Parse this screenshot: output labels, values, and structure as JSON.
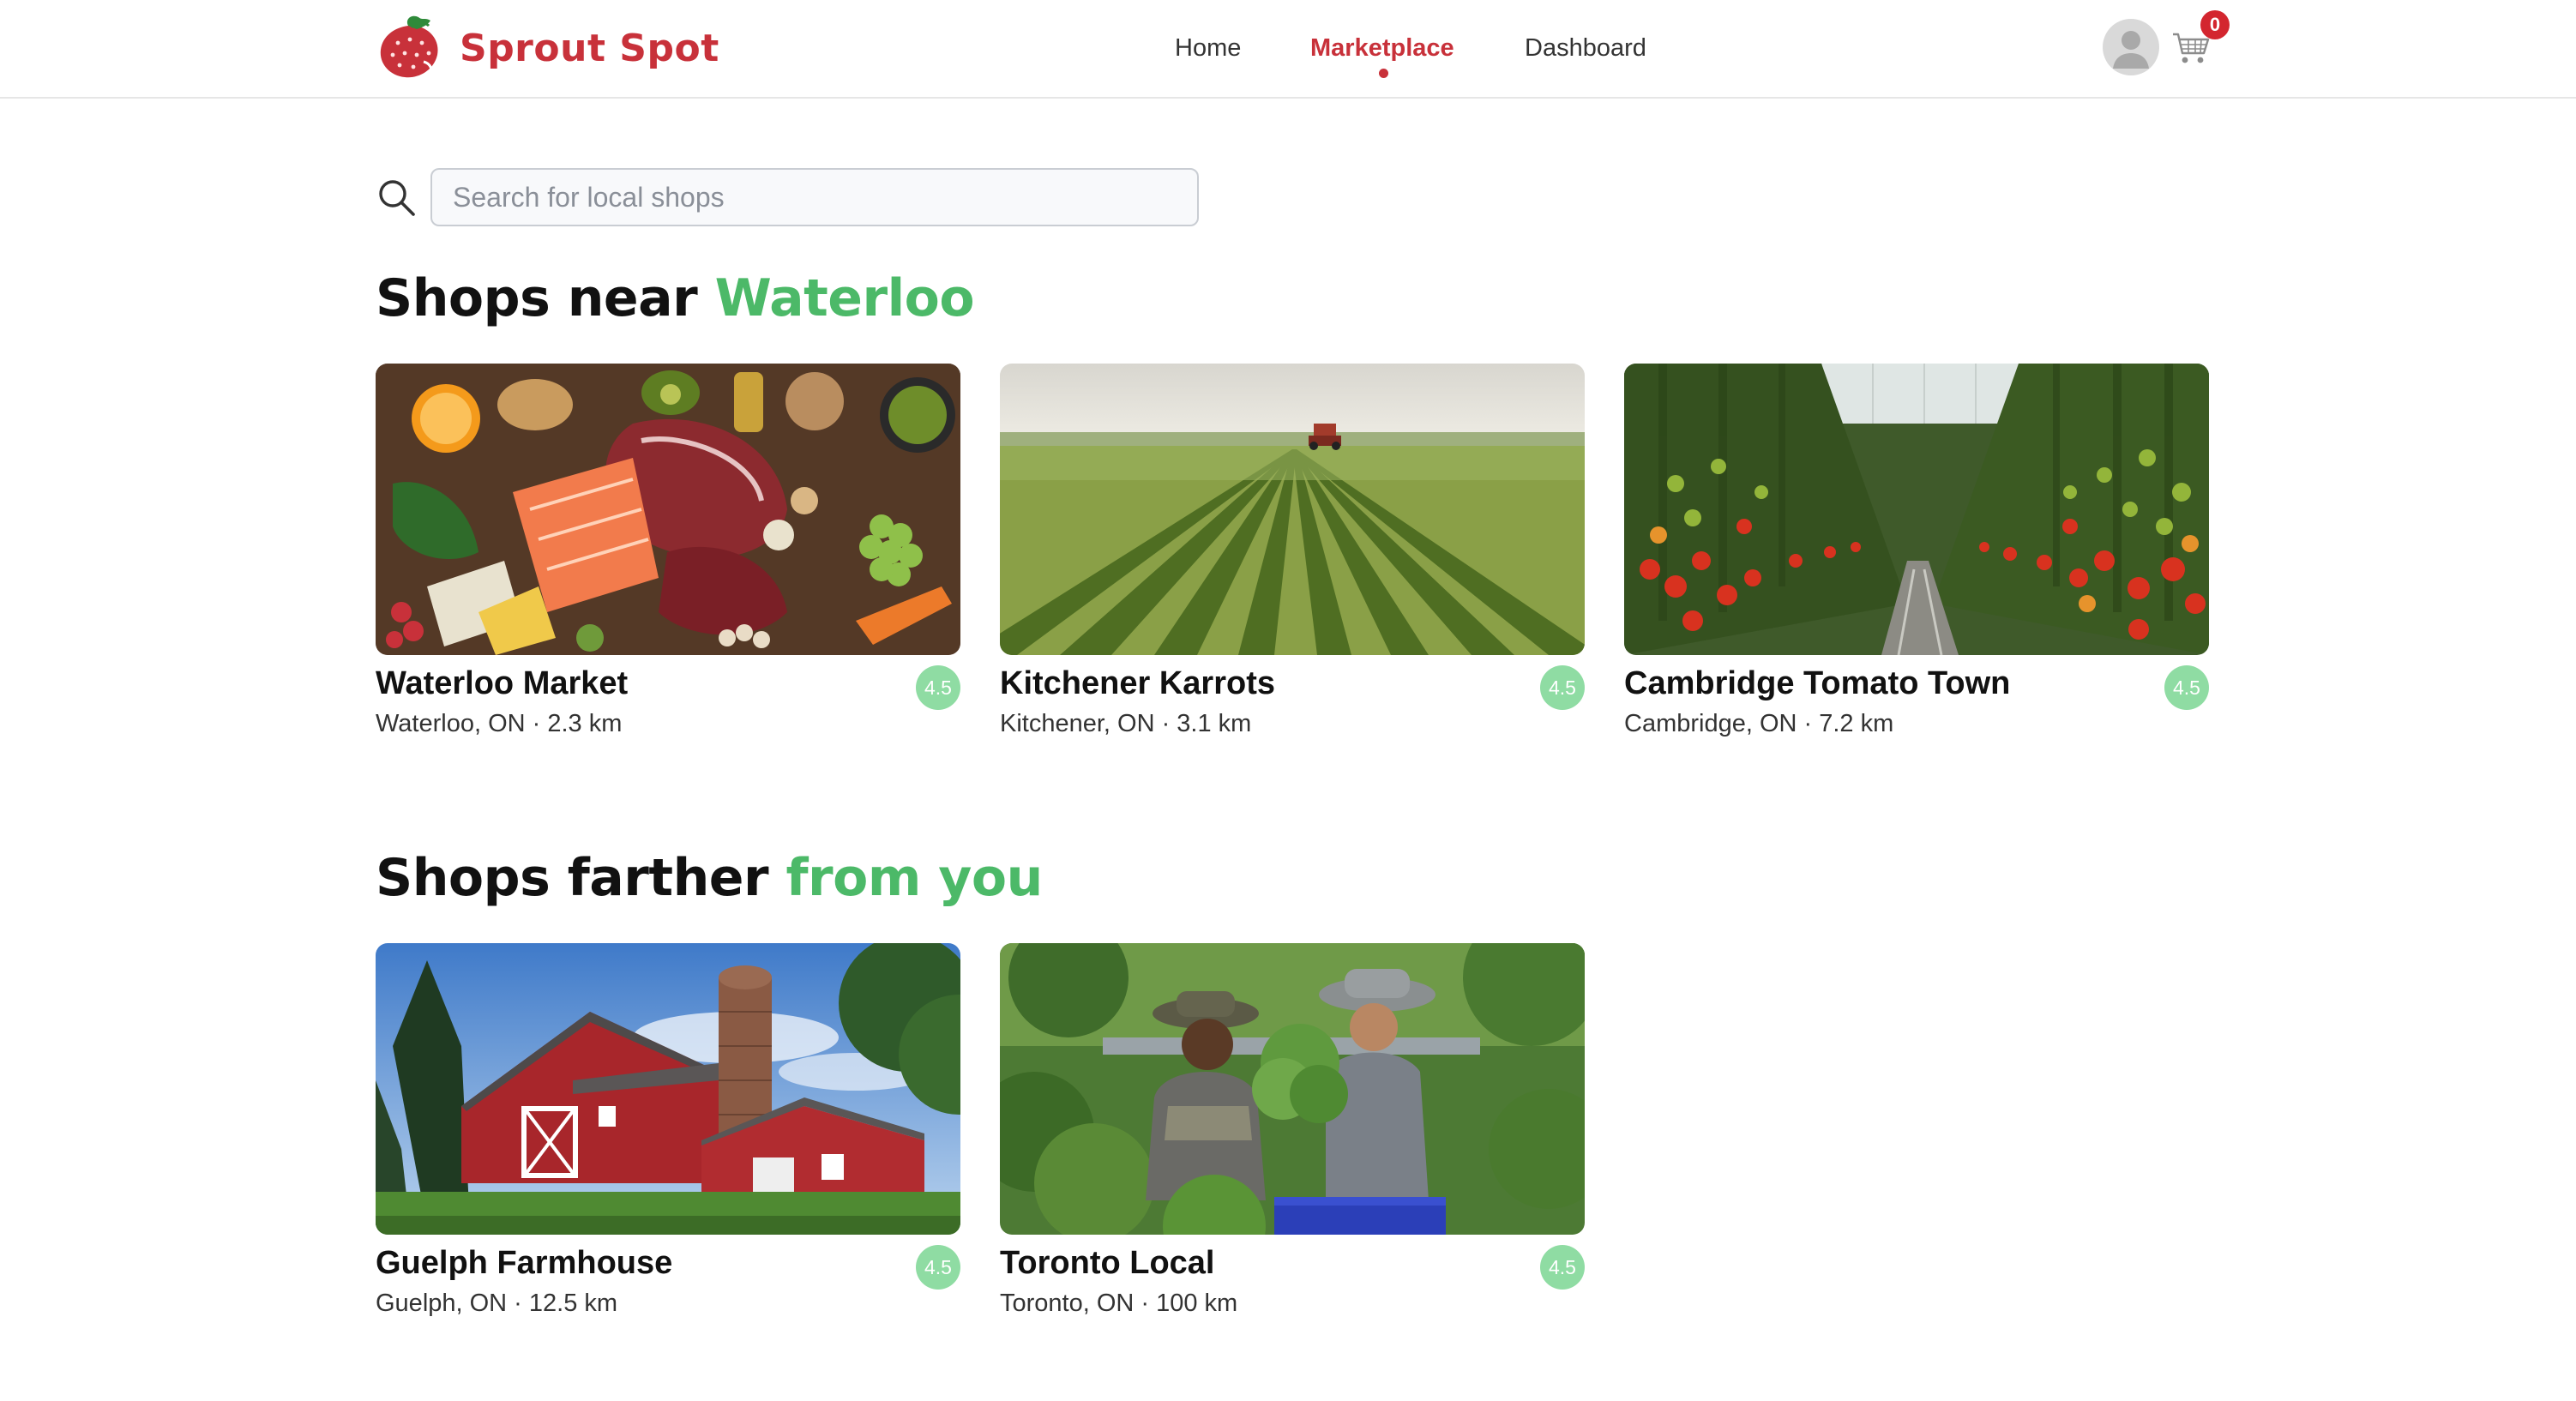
{
  "brand": {
    "name": "Sprout Spot",
    "color": "#c8313a"
  },
  "nav": {
    "home": "Home",
    "marketplace": "Marketplace",
    "dashboard": "Dashboard",
    "active": "Marketplace"
  },
  "header": {
    "avatar_icon": "user-avatar-icon",
    "cart_icon": "shopping-cart-icon",
    "cart_count": "0"
  },
  "search": {
    "placeholder": "Search for local shops",
    "value": "",
    "icon": "search-icon"
  },
  "sections": {
    "near": {
      "title_prefix": "Shops near",
      "title_highlight": "Waterloo",
      "shops": [
        {
          "name": "Waterloo Market",
          "location": "Waterloo, ON · 2.3 km",
          "rating": "4.5",
          "image": "grocery-spread"
        },
        {
          "name": "Kitchener Karrots",
          "location": "Kitchener, ON · 3.1 km",
          "rating": "4.5",
          "image": "crop-field-tractor"
        },
        {
          "name": "Cambridge Tomato Town",
          "location": "Cambridge, ON · 7.2 km",
          "rating": "4.5",
          "image": "tomato-greenhouse"
        }
      ]
    },
    "far": {
      "title_prefix": "Shops farther",
      "title_highlight": "from you",
      "shops": [
        {
          "name": "Guelph Farmhouse",
          "location": "Guelph, ON · 12.5 km",
          "rating": "4.5",
          "image": "red-barn-silo"
        },
        {
          "name": "Toronto Local",
          "location": "Toronto, ON · 100 km",
          "rating": "4.5",
          "image": "gardeners-harvest"
        }
      ]
    }
  },
  "colors": {
    "accent_red": "#c8313a",
    "accent_green": "#4cb968",
    "rating_badge": "#8fdca3",
    "cart_badge": "#d3262f"
  }
}
